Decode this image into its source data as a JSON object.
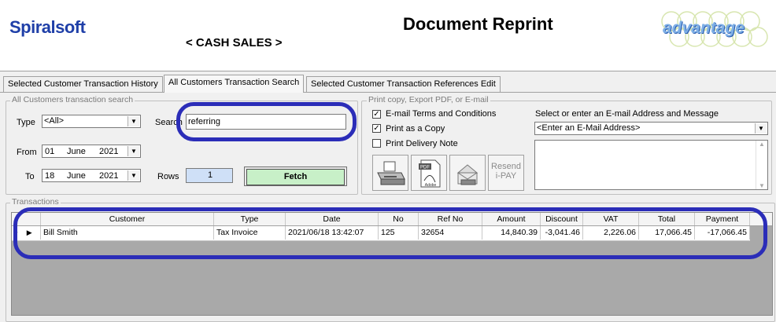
{
  "header": {
    "logo_text": "Spiralsoft",
    "title": "Document Reprint",
    "subtitle": "< CASH SALES >",
    "brand_text": "advantage"
  },
  "tabs": [
    {
      "label": "Selected Customer Transaction History"
    },
    {
      "label": "All Customers Transaction Search"
    },
    {
      "label": "Selected Customer Transaction References Edit"
    }
  ],
  "search": {
    "group_title": "All Customers transaction search",
    "type_label": "Type",
    "type_value": "<All>",
    "search_label": "Search",
    "search_value": "referring",
    "from_label": "From",
    "from_day": "01",
    "from_month": "June",
    "from_year": "2021",
    "to_label": "To",
    "to_day": "18",
    "to_month": "June",
    "to_year": "2021",
    "rows_label": "Rows",
    "rows_value": "1",
    "fetch_label": "Fetch"
  },
  "print": {
    "group_title": "Print copy, Export PDF, or E-mail",
    "options": [
      {
        "label": "E-mail Terms and Conditions",
        "checked": true
      },
      {
        "label": "Print as a Copy",
        "checked": true
      },
      {
        "label": "Print Delivery Note",
        "checked": false
      }
    ],
    "email_label": "Select or enter an E-mail Address and Message",
    "email_value": "<Enter an E-Mail Address>",
    "resend_line1": "Resend",
    "resend_line2": "i-PAY"
  },
  "transactions": {
    "group_title": "Transactions",
    "columns": [
      "Customer",
      "Type",
      "Date",
      "No",
      "Ref No",
      "Amount",
      "Discount",
      "VAT",
      "Total",
      "Payment"
    ],
    "rows": [
      {
        "customer": "Bill Smith",
        "type": "Tax Invoice",
        "date": "2021/06/18 13:42:07",
        "no": "125",
        "ref_no": "32654",
        "amount": "14,840.39",
        "discount": "-3,041.46",
        "vat": "2,226.06",
        "total": "17,066.45",
        "payment": "-17,066.45"
      }
    ]
  }
}
